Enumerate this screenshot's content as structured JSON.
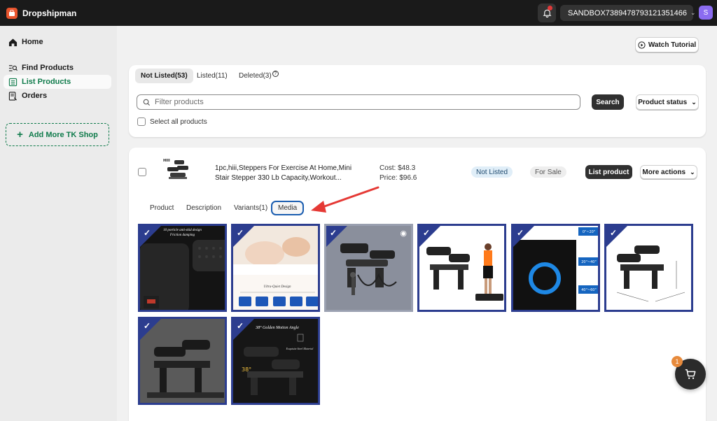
{
  "app": {
    "name": "Dropshipman",
    "notification_count": "1"
  },
  "store_selector": {
    "value": "SANDBOX7389478793121351466"
  },
  "user": {
    "avatar_initial": "S"
  },
  "sidebar": {
    "items": [
      {
        "label": "Home",
        "icon": "home-icon"
      },
      {
        "label": "Find Products",
        "icon": "find-products-icon"
      },
      {
        "label": "List Products",
        "icon": "list-products-icon",
        "active": true
      },
      {
        "label": "Orders",
        "icon": "orders-icon"
      }
    ],
    "add_shop_label": "Add More TK Shop"
  },
  "header": {
    "watch_tutorial_label": "Watch Tutorial"
  },
  "tabs": [
    {
      "label": "Not Listed(53)",
      "active": true
    },
    {
      "label": "Listed(11)"
    },
    {
      "label": "Deleted(3)"
    }
  ],
  "filter": {
    "placeholder": "Filter products",
    "search_label": "Search",
    "status_label": "Product status"
  },
  "select_all_label": "Select all products",
  "product": {
    "title": "1pc,hiii,Steppers For Exercise At Home,Mini Stair Stepper 330 Lb Capacity,Workout...",
    "cost": "Cost: $48.3",
    "price": "Price: $96.6",
    "status_badge": "Not Listed",
    "sale_badge": "For Sale",
    "list_button": "List product",
    "more_actions": "More actions",
    "subtabs": [
      "Product",
      "Description",
      "Variants(1)",
      "Media"
    ],
    "active_subtab": "Media",
    "media_captions": {
      "m1": "10 porticle anti-skid design",
      "m1b": "Friction damping",
      "m2": "Ultra-Quiet Design",
      "m3": "",
      "m5a": "0\"~20\"",
      "m5b": "20\"~40\"",
      "m5c": "40\"~60\"",
      "m8": "38° Golden Motion Angle",
      "m8b": "Exquisite Steel Material",
      "m8c": "38°"
    }
  },
  "cart": {
    "count": "1"
  },
  "colors": {
    "accent_green": "#0f7b4b",
    "media_border": "#2c3d8f",
    "arrow_red": "#e53935"
  }
}
